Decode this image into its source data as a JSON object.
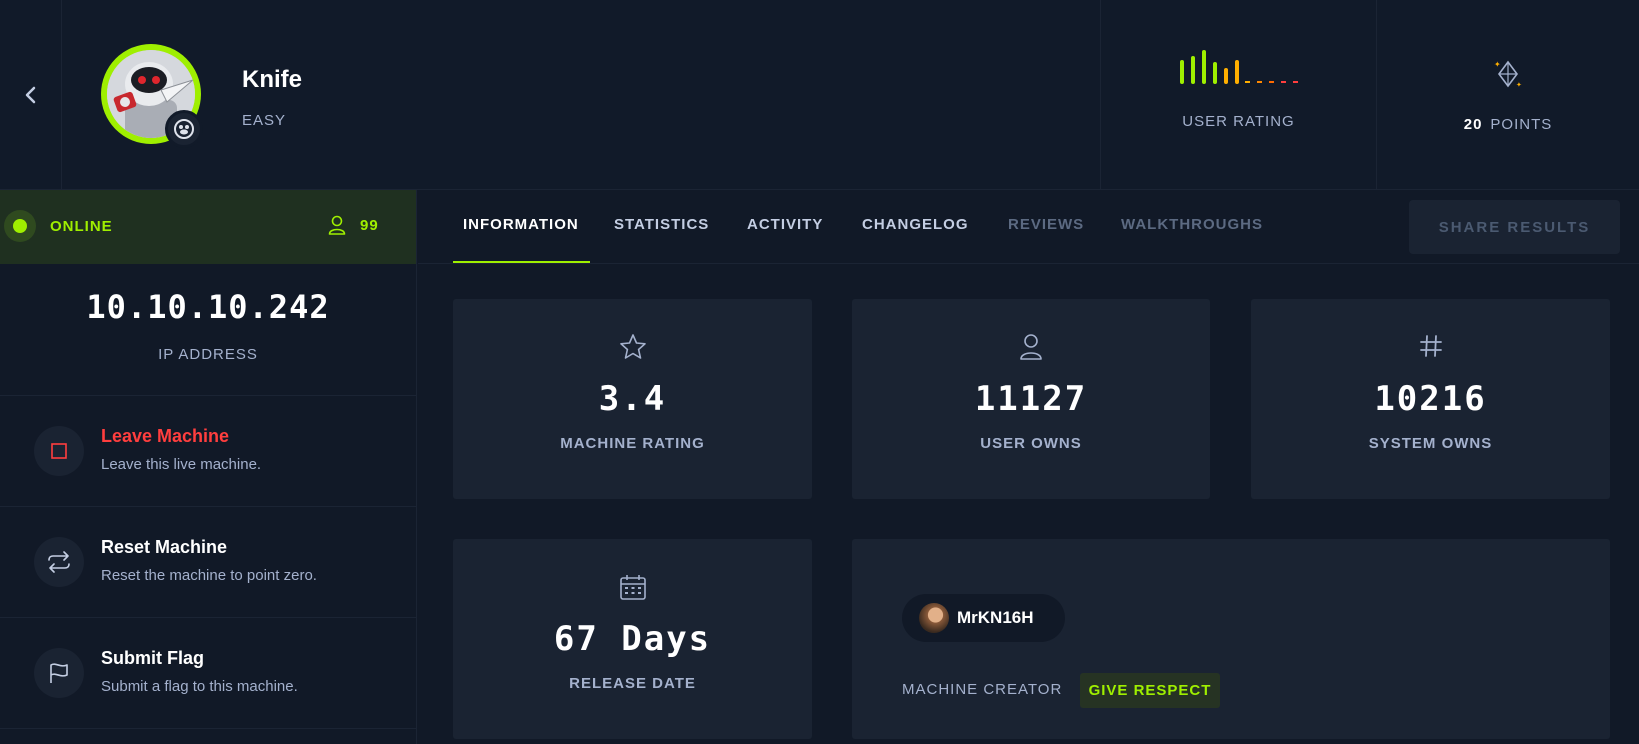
{
  "machine": {
    "name": "Knife",
    "difficulty": "EASY",
    "os_icon": "linux-penguin-icon"
  },
  "header": {
    "user_rating_label": "USER RATING",
    "points_value": "20",
    "points_label": "POINTS"
  },
  "status": {
    "text": "ONLINE",
    "players": "99"
  },
  "ip": {
    "value": "10.10.10.242",
    "label": "IP ADDRESS"
  },
  "actions": [
    {
      "title": "Leave Machine",
      "description": "Leave this live machine.",
      "icon": "stop-square-icon"
    },
    {
      "title": "Reset Machine",
      "description": "Reset the machine to point zero.",
      "icon": "reset-arrows-icon"
    },
    {
      "title": "Submit Flag",
      "description": "Submit a flag to this machine.",
      "icon": "flag-icon"
    }
  ],
  "tabs": [
    {
      "label": "INFORMATION",
      "state": "active"
    },
    {
      "label": "STATISTICS",
      "state": "normal"
    },
    {
      "label": "ACTIVITY",
      "state": "normal"
    },
    {
      "label": "CHANGELOG",
      "state": "normal"
    },
    {
      "label": "REVIEWS",
      "state": "disabled"
    },
    {
      "label": "WALKTHROUGHS",
      "state": "disabled"
    }
  ],
  "share_button": "SHARE RESULTS",
  "stats": [
    {
      "value": "3.4",
      "label": "MACHINE RATING",
      "icon": "star-icon"
    },
    {
      "value": "11127",
      "label": "USER OWNS",
      "icon": "user-icon"
    },
    {
      "value": "10216",
      "label": "SYSTEM OWNS",
      "icon": "hash-icon"
    },
    {
      "value": "67 Days",
      "label": "RELEASE DATE",
      "icon": "calendar-icon"
    }
  ],
  "creator": {
    "name": "MrKN16H",
    "label": "MACHINE CREATOR",
    "respect_button": "GIVE RESPECT"
  },
  "colors": {
    "accent": "#9fef00",
    "danger": "#ff3e3e",
    "background": "#111927",
    "card": "#1a2332",
    "muted": "#a4b1cd"
  }
}
